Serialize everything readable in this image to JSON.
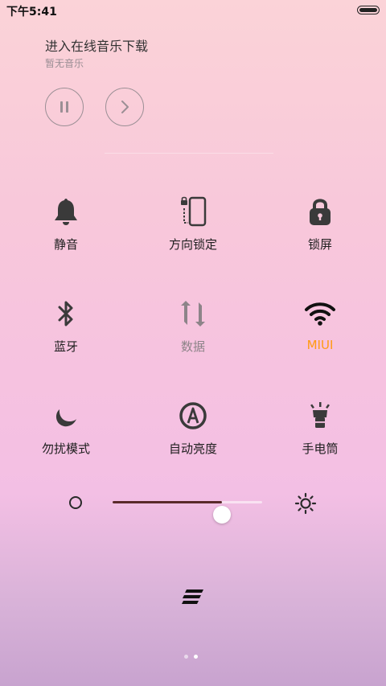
{
  "status_bar": {
    "time": "下午5:41",
    "battery_icon": "battery-icon"
  },
  "music": {
    "title": "进入在线音乐下载",
    "subtitle": "暂无音乐",
    "controls": [
      {
        "icon": "pause-icon"
      },
      {
        "icon": "next-icon"
      }
    ]
  },
  "toggles": [
    {
      "label": "静音",
      "icon": "bell-icon"
    },
    {
      "label": "方向锁定",
      "icon": "rotation-lock-icon"
    },
    {
      "label": "锁屏",
      "icon": "padlock-icon"
    },
    {
      "label": "蓝牙",
      "icon": "bluetooth-icon"
    },
    {
      "label": "数据",
      "icon": "data-sync-icon",
      "state": "off"
    },
    {
      "label": "MIUI",
      "icon": "wifi-icon",
      "state": "on"
    },
    {
      "label": "勿扰模式",
      "icon": "moon-icon"
    },
    {
      "label": "自动亮度",
      "icon": "auto-brightness-icon"
    },
    {
      "label": "手电筒",
      "icon": "flashlight-icon"
    }
  ],
  "brightness": {
    "level": 0.73,
    "low_icon": "brightness-low-icon",
    "high_icon": "sun-icon"
  },
  "bottom": {
    "menu_icon": "menu-icon",
    "page_count": 2,
    "active_page": 2
  },
  "colors": {
    "accent": "#ff9a12",
    "icon": "#3a3a3a",
    "dim_icon": "#8d8489"
  }
}
